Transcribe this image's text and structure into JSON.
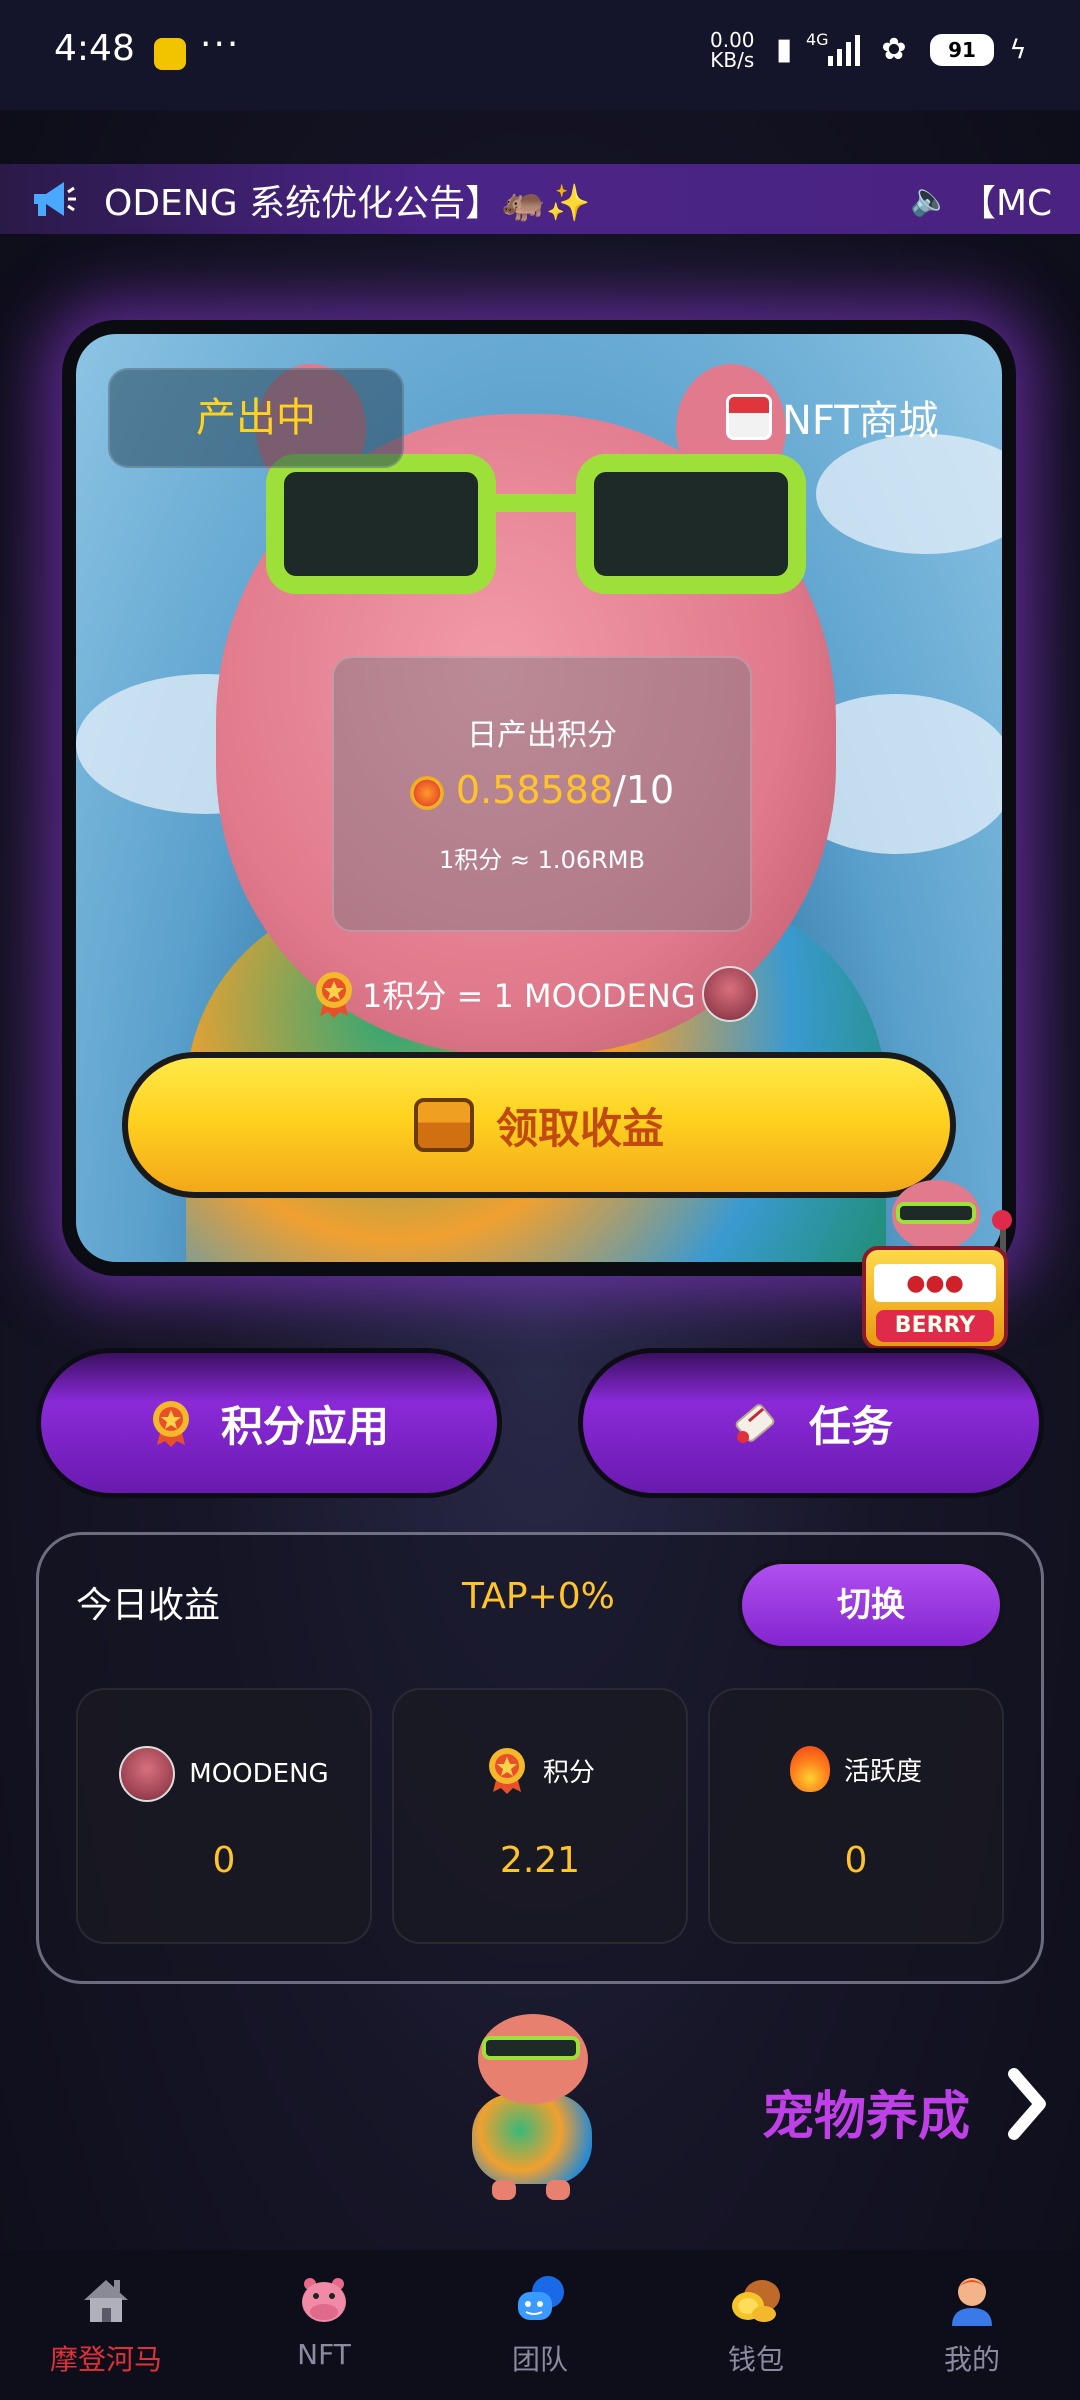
{
  "status_bar": {
    "time": "4:48",
    "dots": "···",
    "net_speed_top": "0.00",
    "net_speed_bottom": "KB/s",
    "signal": "4G",
    "battery": "91"
  },
  "announcement": {
    "text": "ODENG 系统优化公告】🦛✨",
    "text_next": "【MC"
  },
  "hero": {
    "status_badge": "产出中",
    "nft_mall_label": "NFT商城",
    "daily_title": "日产出积分",
    "daily_value": "0.58588",
    "daily_max": "/10",
    "rate_rmb": "1积分 ≈ 1.06RMB",
    "rate_moodeng": "1积分 = 1 MOODENG",
    "claim_label": "领取收益"
  },
  "slot": {
    "label": "BERRY"
  },
  "actions": {
    "points_label": "积分应用",
    "tasks_label": "任务"
  },
  "earnings": {
    "title": "今日收益",
    "tap_label": "TAP+0%",
    "switch_label": "切换",
    "cards": [
      {
        "label": "MOODENG",
        "value": "0"
      },
      {
        "label": "积分",
        "value": "2.21"
      },
      {
        "label": "活跃度",
        "value": "0"
      }
    ]
  },
  "pet": {
    "label": "宠物养成"
  },
  "nav": {
    "items": [
      {
        "label": "摩登河马",
        "icon": "house-icon",
        "active": true
      },
      {
        "label": "NFT",
        "icon": "hippo-face-icon",
        "active": false
      },
      {
        "label": "团队",
        "icon": "chat-bubbles-icon",
        "active": false
      },
      {
        "label": "钱包",
        "icon": "coins-icon",
        "active": false
      },
      {
        "label": "我的",
        "icon": "user-icon",
        "active": false
      }
    ]
  },
  "colors": {
    "accent_purple": "#8a2ad8",
    "gold": "#ffc42a",
    "active_nav": "#e0303a"
  }
}
